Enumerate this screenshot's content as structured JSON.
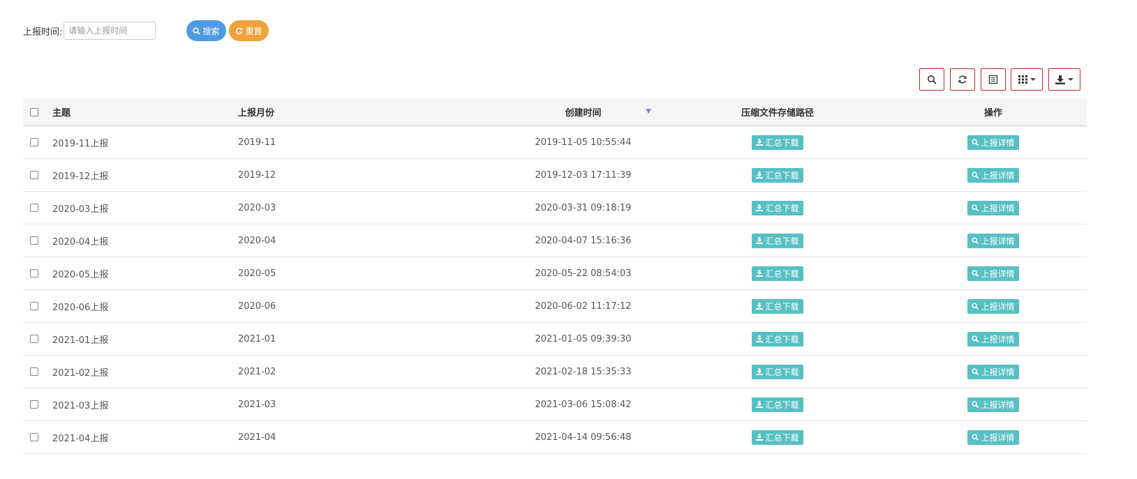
{
  "search": {
    "label": "上报时间:",
    "placeholder": "请输入上报时间",
    "search_button": "搜索",
    "reset_button": "重置"
  },
  "table": {
    "headers": {
      "topic": "主题",
      "month": "上报月份",
      "created": "创建时间",
      "path": "压缩文件存储路径",
      "operation": "操作"
    },
    "download_label": "汇总下载",
    "detail_label": "上报详情",
    "rows": [
      {
        "topic": "2019-11上报",
        "month": "2019-11",
        "created": "2019-11-05 10:55:44"
      },
      {
        "topic": "2019-12上报",
        "month": "2019-12",
        "created": "2019-12-03 17:11:39"
      },
      {
        "topic": "2020-03上报",
        "month": "2020-03",
        "created": "2020-03-31 09:18:19"
      },
      {
        "topic": "2020-04上报",
        "month": "2020-04",
        "created": "2020-04-07 15:16:36"
      },
      {
        "topic": "2020-05上报",
        "month": "2020-05",
        "created": "2020-05-22 08:54:03"
      },
      {
        "topic": "2020-06上报",
        "month": "2020-06",
        "created": "2020-06-02 11:17:12"
      },
      {
        "topic": "2021-01上报",
        "month": "2021-01",
        "created": "2021-01-05 09:39:30"
      },
      {
        "topic": "2021-02上报",
        "month": "2021-02",
        "created": "2021-02-18 15:35:33"
      },
      {
        "topic": "2021-03上报",
        "month": "2021-03",
        "created": "2021-03-06 15:08:42"
      },
      {
        "topic": "2021-04上报",
        "month": "2021-04",
        "created": "2021-04-14 09:56:48"
      }
    ]
  },
  "icons": {
    "search": "search-icon",
    "refresh": "refresh-icon",
    "toggle": "toggle-view-icon",
    "columns": "columns-grid-icon",
    "export": "export-download-icon"
  },
  "colors": {
    "search_button": "#4f9ae5",
    "reset_button": "#f1a33b",
    "teal_button": "#57c0c3",
    "toolbar_border": "#b52a2a",
    "sort_arrow": "#8a7fd4"
  }
}
